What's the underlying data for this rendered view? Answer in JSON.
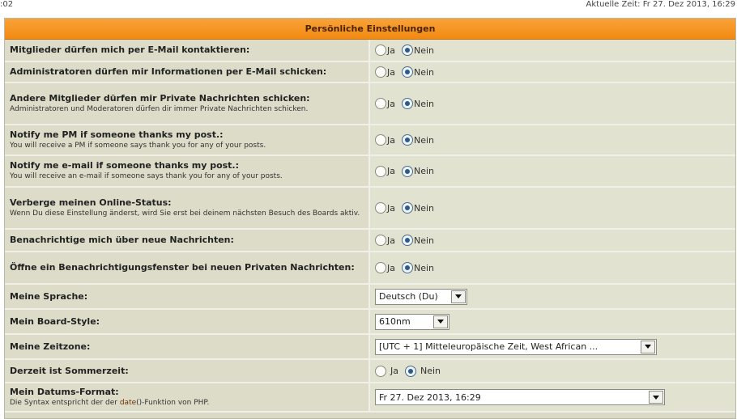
{
  "topbar": {
    "left_text": ":02",
    "right_text": "Aktuelle Zeit: Fr 27. Dez 2013, 16:29"
  },
  "panel": {
    "title": "Persönliche Einstellungen"
  },
  "radio": {
    "yes": "Ja",
    "no": "Nein"
  },
  "rows": [
    {
      "title": "Mitglieder dürfen mich per E-Mail kontaktieren:",
      "desc": "",
      "selected": "no"
    },
    {
      "title": "Administratoren dürfen mir Informationen per E-Mail schicken:",
      "desc": "",
      "selected": "no"
    },
    {
      "title": "Andere Mitglieder dürfen mir Private Nachrichten schicken:",
      "desc": "Administratoren und Moderatoren dürfen dir immer Private Nachrichten schicken.",
      "selected": "no"
    },
    {
      "title": "Notify me PM if someone thanks my post.:",
      "desc": "You will receive a PM if someone says thank you for any of your posts.",
      "selected": "no"
    },
    {
      "title": "Notify me e-mail if someone thanks my post.:",
      "desc": "You will receive an e-mail if someone says thank you for any of your posts.",
      "selected": "no"
    },
    {
      "title": "Verberge meinen Online-Status:",
      "desc": "Wenn Du diese Einstellung änderst, wird Sie erst bei deinem nächsten Besuch des Boards aktiv.",
      "selected": "no"
    },
    {
      "title": "Benachrichtige mich über neue Nachrichten:",
      "desc": "",
      "selected": "no"
    },
    {
      "title": "Öffne ein Benachrichtigungsfenster bei neuen Privaten Nachrichten:",
      "desc": "",
      "selected": "no"
    }
  ],
  "language": {
    "label": "Meine Sprache:",
    "value": "Deutsch (Du)"
  },
  "style": {
    "label": "Mein Board-Style:",
    "value": "610nm"
  },
  "timezone": {
    "label": "Meine Zeitzone:",
    "value": "[UTC + 1] Mitteleuropäische Zeit, West African ..."
  },
  "dst": {
    "label": "Derzeit ist Sommerzeit:",
    "yes": "Ja",
    "no": "Nein",
    "selected": "no"
  },
  "dateformat": {
    "label": "Mein Datums-Format:",
    "desc_prefix": "Die Syntax entspricht der der ",
    "desc_fn": "date",
    "desc_paren": "()",
    "desc_suffix": "-Funktion von PHP.",
    "value": "Fr 27. Dez 2013, 16:29"
  }
}
